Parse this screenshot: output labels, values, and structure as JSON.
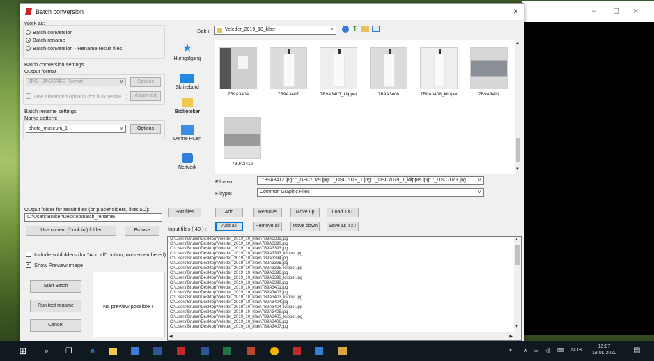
{
  "window": {
    "title": "Batch conversion",
    "close": "×"
  },
  "background_window": {
    "min": "–",
    "max": "☐",
    "close": "×"
  },
  "work_as": {
    "label": "Work as:",
    "options": [
      "Batch conversion",
      "Batch rename",
      "Batch conversion - Rename result files"
    ],
    "selected_index": 1
  },
  "conversion": {
    "label": "Batch conversion settings",
    "output_format_label": "Output format",
    "format_value": "JPG - JPG/JPEG Format",
    "options_button": "Options",
    "advanced_checkbox": "Use advanced options (for bulk resize...)",
    "advanced_button": "Advanced"
  },
  "rename": {
    "label": "Batch rename settings",
    "name_pattern_label": "Name pattern:",
    "pattern_value": "photo_museum_1",
    "options_button": "Options"
  },
  "output": {
    "label": "Output folder for result files (or placeholders, like: $D):",
    "path_value": "C:\\Users\\Bruker\\Desktop\\batch_rename\\",
    "use_current_button": "Use current ('Look in') folder",
    "browse_button": "Browse"
  },
  "include_subfolders": {
    "label": "Include subfolders (for \"Add all\" button; not remembered)",
    "checked": false
  },
  "show_preview": {
    "label": "Show Preview image",
    "checked": true
  },
  "actions": {
    "start": "Start Batch",
    "test": "Run test rename",
    "cancel": "Cancel"
  },
  "preview_text": "No preview possible !",
  "lookin": {
    "label": "Søk i:",
    "value": "Veleder_2019_10_klær"
  },
  "places": [
    "Hurtigtilgang",
    "Skrivebord",
    "Biblioteker",
    "Denne PCen",
    "Nettverk"
  ],
  "files": [
    "7B9A3404",
    "7B9A3407",
    "7B9A3407_klippet",
    "7B9A3408",
    "7B9A3408_klippet",
    "7B9A3411",
    "7B9A3412"
  ],
  "filename": {
    "label": "Filnavn:",
    "value": "\"7B9A3412.jpg\" \"_DSC7079.jpg\" \"_DSC7079_1.jpg\" \"_DSC7079_1_klippet.jpg\" \"_DSC7079.jpg"
  },
  "filetype": {
    "label": "Filtype:",
    "value": "Common Graphic Files"
  },
  "list_buttons": {
    "sort": "Sort files",
    "add": "Add",
    "remove": "Remove",
    "move_up": "Move up",
    "load": "Load TXT",
    "add_all": "Add all",
    "remove_all": "Remove all",
    "move_down": "Move down",
    "save": "Save as TXT"
  },
  "input_files_label": "Input files ( 49 ) :",
  "input_files": [
    "C:\\Users\\Bruker\\Desktop\\Veleder_2019_10_klær\\7B9A3389.jpg",
    "C:\\Users\\Bruker\\Desktop\\Veleder_2019_10_klær\\7B9A3390.jpg",
    "C:\\Users\\Bruker\\Desktop\\Veleder_2019_10_klær\\7B9A3393.jpg",
    "C:\\Users\\Bruker\\Desktop\\Veleder_2019_10_klær\\7B9A3393_klippet.jpg",
    "C:\\Users\\Bruker\\Desktop\\Veleder_2019_10_klær\\7B9A3394.jpg",
    "C:\\Users\\Bruker\\Desktop\\Veleder_2019_10_klær\\7B9A3395.jpg",
    "C:\\Users\\Bruker\\Desktop\\Veleder_2019_10_klær\\7B9A3395_klippet.jpg",
    "C:\\Users\\Bruker\\Desktop\\Veleder_2019_10_klær\\7B9A3396.jpg",
    "C:\\Users\\Bruker\\Desktop\\Veleder_2019_10_klær\\7B9A3396_klippet.jpg",
    "C:\\Users\\Bruker\\Desktop\\Veleder_2019_10_klær\\7B9A3398.jpg",
    "C:\\Users\\Bruker\\Desktop\\Veleder_2019_10_klær\\7B9A3401.jpg",
    "C:\\Users\\Bruker\\Desktop\\Veleder_2019_10_klær\\7B9A3403.jpg",
    "C:\\Users\\Bruker\\Desktop\\Veleder_2019_10_klær\\7B9A3403_klippet.jpg",
    "C:\\Users\\Bruker\\Desktop\\Veleder_2019_10_klær\\7B9A3404.jpg",
    "C:\\Users\\Bruker\\Desktop\\Veleder_2019_10_klær\\7B9A3404_klippet.jpg",
    "C:\\Users\\Bruker\\Desktop\\Veleder_2019_10_klær\\7B9A3405.jpg",
    "C:\\Users\\Bruker\\Desktop\\Veleder_2019_10_klær\\7B9A3405_klippet.jpg",
    "C:\\Users\\Bruker\\Desktop\\Veleder_2019_10_klær\\7B9A3406.jpg",
    "C:\\Users\\Bruker\\Desktop\\Veleder_2019_10_klær\\7B9A3407.jpg"
  ],
  "taskbar": {
    "tray_lang": "NOB",
    "time": "12:07",
    "date": "18.01.2020"
  },
  "colors": {
    "accent": "#0078d7",
    "taskbar": "#101820"
  }
}
